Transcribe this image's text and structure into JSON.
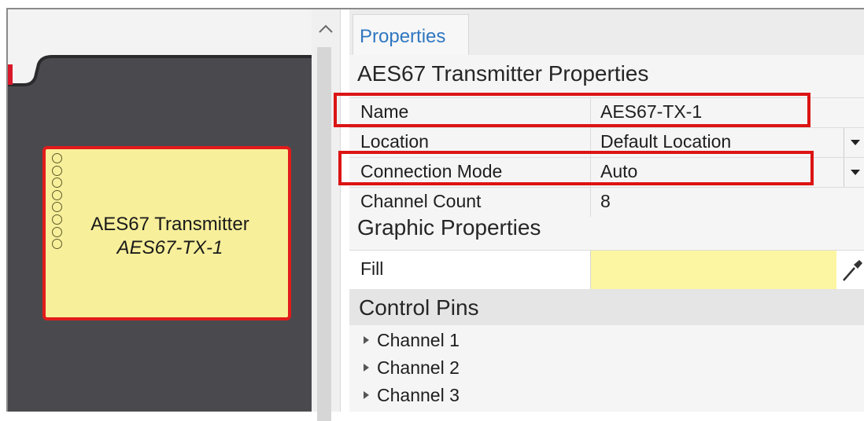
{
  "properties_tab": {
    "label": "Properties"
  },
  "component": {
    "type_label": "AES67 Transmitter",
    "instance_name": "AES67-TX-1",
    "pin_count": 8
  },
  "section_main": {
    "title": "AES67 Transmitter Properties",
    "rows": [
      {
        "name": "Name",
        "value": "AES67-TX-1"
      },
      {
        "name": "Location",
        "value": "Default Location"
      },
      {
        "name": "Connection Mode",
        "value": "Auto"
      },
      {
        "name": "Channel Count",
        "value": "8"
      }
    ]
  },
  "section_graphic": {
    "title": "Graphic Properties",
    "fill_label": "Fill",
    "fill_color": "#fcf5a1"
  },
  "control_pins": {
    "title": "Control Pins",
    "items": [
      "Channel 1",
      "Channel 2",
      "Channel 3"
    ]
  },
  "colors": {
    "highlight": "#dc1414",
    "tab_text": "#2f77c0",
    "block_fill": "#f7ef9a"
  },
  "icons": {
    "scroll_up": "chevron-up-icon",
    "dropdown": "chevron-down-icon",
    "fill_picker": "eyedropper-icon",
    "expand": "triangle-right-icon"
  }
}
